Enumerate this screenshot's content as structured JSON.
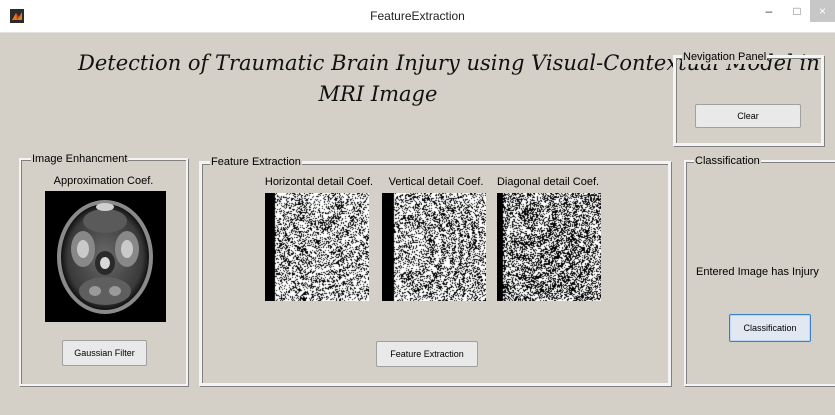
{
  "window": {
    "title": "FeatureExtraction",
    "minimize_glyph": "–",
    "maximize_glyph": "□",
    "close_glyph": "×"
  },
  "main_title": {
    "line1": "Detection of Traumatic Brain Injury using Visual-Contextual Model in",
    "line2": "MRI Image"
  },
  "navigation_panel": {
    "title": "Nevigation Panel",
    "clear_button": "Clear"
  },
  "image_enhancement": {
    "title": "Image Enhancment",
    "image_label": "Approximation Coef.",
    "gaussian_button": "Gaussian Filter"
  },
  "feature_extraction": {
    "title": "Feature Extraction",
    "horizontal_label": "Horizontal detail Coef.",
    "vertical_label": "Vertical detail Coef.",
    "diagonal_label": "Diagonal detail Coef.",
    "button": "Feature Extraction"
  },
  "classification": {
    "title": "Classification",
    "result_text": "Entered Image has  Injury",
    "button": "Classification"
  },
  "colors": {
    "window_bg": "#d4d0c8",
    "focus_border": "#3a80c8"
  },
  "icons": [
    "matlab-icon"
  ]
}
